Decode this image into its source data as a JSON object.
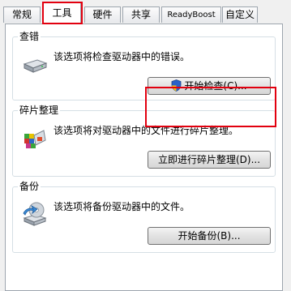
{
  "tabs": [
    {
      "label": "常规",
      "active": false
    },
    {
      "label": "工具",
      "active": true
    },
    {
      "label": "硬件",
      "active": false
    },
    {
      "label": "共享",
      "active": false
    },
    {
      "label": "ReadyBoost",
      "active": false
    },
    {
      "label": "自定义",
      "active": false
    }
  ],
  "sections": {
    "error_check": {
      "title": "查错",
      "description": "该选项将检查驱动器中的错误。",
      "button": "开始检查(C)...",
      "icon": "drive-icon"
    },
    "defrag": {
      "title": "碎片整理",
      "description": "该选项将对驱动器中的文件进行碎片整理。",
      "button": "立即进行碎片整理(D)...",
      "icon": "defrag-icon"
    },
    "backup": {
      "title": "备份",
      "description": "该选项将备份驱动器中的文件。",
      "button": "开始备份(B)...",
      "icon": "backup-icon"
    }
  },
  "colors": {
    "highlight": "#e2000f",
    "window_bg": "#f0f0f0",
    "border": "#9da5ae"
  }
}
